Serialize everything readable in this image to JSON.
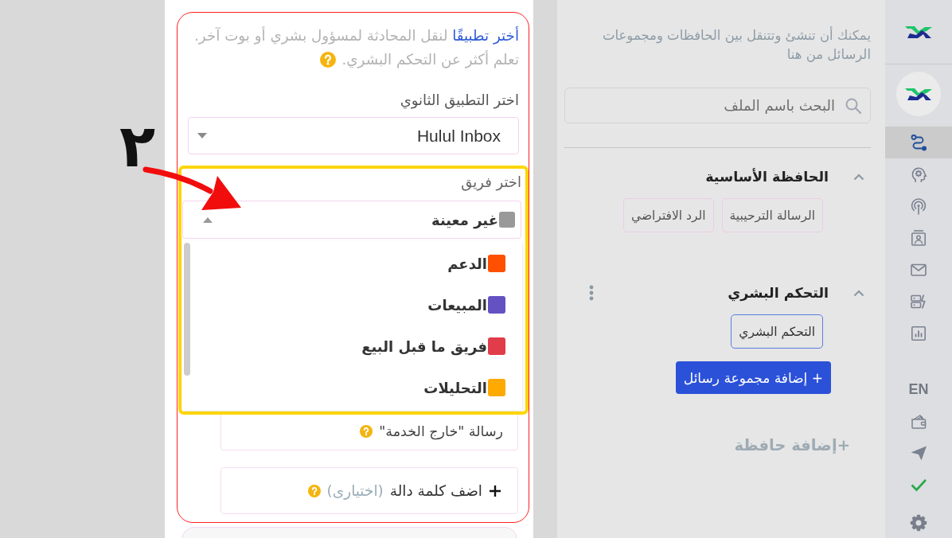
{
  "annotation": {
    "step_number": "٢"
  },
  "handoff_panel": {
    "intro": {
      "link": "أختر تطبيقًا",
      "text": "لنقل المحادثة لمسؤول بشري أو بوت آخر. تعلم أكثر عن التحكم البشري."
    },
    "app_select": {
      "label": "اختر التطبيق الثانوي",
      "value": "Hulul Inbox",
      "expanded": false
    },
    "team_select": {
      "label": "اختر فريق",
      "value": "غير معينة",
      "color": "#999999",
      "expanded": true,
      "options": [
        {
          "label": "الدعم",
          "color": "#ff5000",
          "selected": false
        },
        {
          "label": "المبيعات",
          "color": "#6452c2",
          "selected": false
        },
        {
          "label": "فريق ما قبل البيع",
          "color": "#e03c4a",
          "selected": false
        },
        {
          "label": "التحليلات",
          "color": "#ffaa00",
          "selected": false
        }
      ]
    },
    "out_of_service": {
      "label": "رسالة \"خارج الخدمة\""
    },
    "keyword": {
      "label": "اضف كلمة دالة",
      "optional": "(اختيارى)"
    }
  },
  "folders_panel": {
    "description": "يمكنك أن تنشئ وتتنقل بين الحافظات ومجموعات الرسائل من هنا",
    "search": {
      "placeholder": "البحث باسم الملف"
    },
    "folders": [
      {
        "title": "الحافظة الأساسية",
        "expanded": true,
        "show_menu": false,
        "groups": [
          {
            "label": "الرسالة الترحيبية",
            "selected": false
          },
          {
            "label": "الرد الافتراضي",
            "selected": false
          }
        ]
      },
      {
        "title": "التحكم البشري",
        "expanded": true,
        "show_menu": true,
        "groups": [
          {
            "label": "التحكم البشري",
            "selected": true
          }
        ],
        "add_group_button": "+ إضافة مجموعة رسائل"
      }
    ],
    "add_folder": "+إضافة حافظة"
  },
  "sidebar": {
    "nav_items": [
      {
        "selected": true
      },
      {
        "selected": false
      },
      {
        "selected": false
      },
      {
        "selected": false
      },
      {
        "selected": false
      },
      {
        "selected": false
      },
      {
        "selected": false
      }
    ],
    "language": "EN"
  }
}
